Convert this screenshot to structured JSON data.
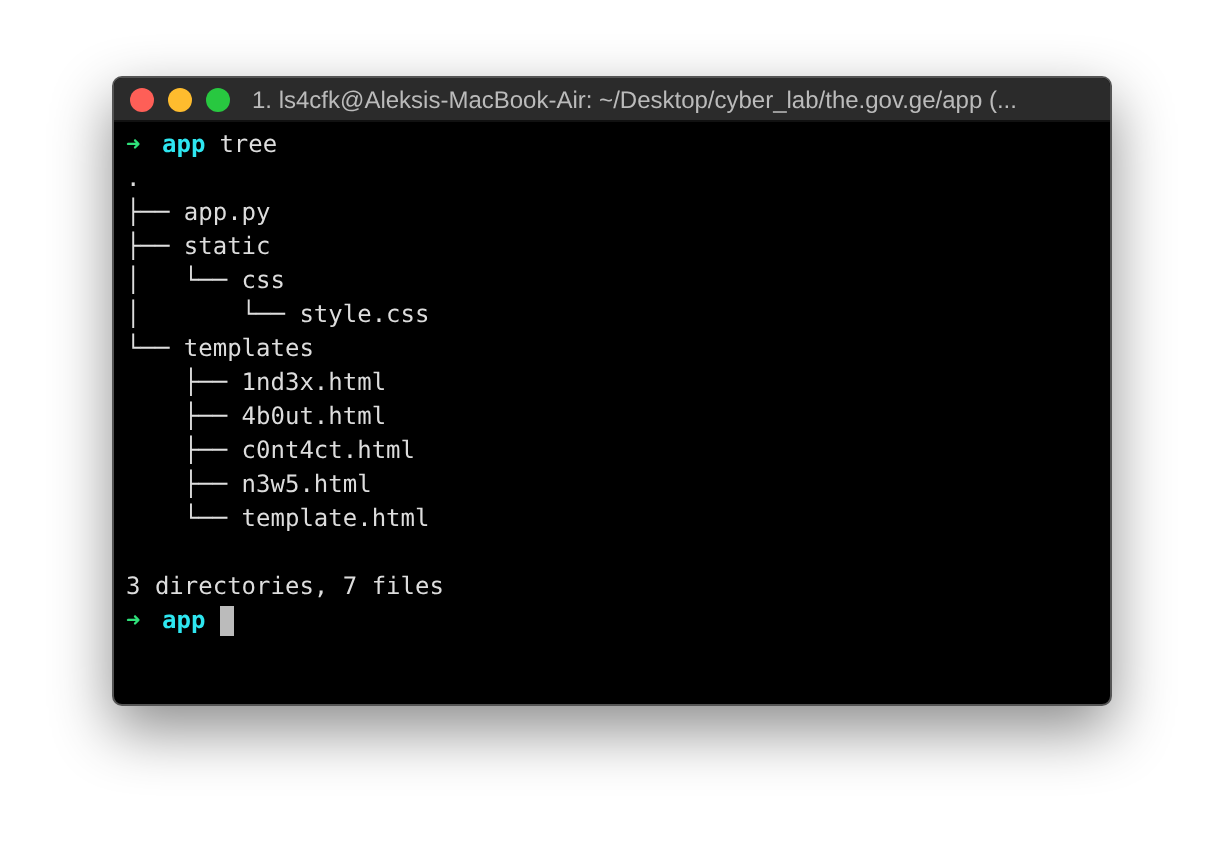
{
  "window": {
    "title": "1. ls4cfk@Aleksis-MacBook-Air: ~/Desktop/cyber_lab/the.gov.ge/app (..."
  },
  "lines": [
    {
      "kind": "prompt",
      "arrow": "➜",
      "directory": "app",
      "command": "tree",
      "cursor": false
    },
    {
      "kind": "output",
      "text": "."
    },
    {
      "kind": "output",
      "text": "├── app.py"
    },
    {
      "kind": "output",
      "text": "├── static"
    },
    {
      "kind": "output",
      "text": "│   └── css"
    },
    {
      "kind": "output",
      "text": "│       └── style.css"
    },
    {
      "kind": "output",
      "text": "└── templates"
    },
    {
      "kind": "output",
      "text": "    ├── 1nd3x.html"
    },
    {
      "kind": "output",
      "text": "    ├── 4b0ut.html"
    },
    {
      "kind": "output",
      "text": "    ├── c0nt4ct.html"
    },
    {
      "kind": "output",
      "text": "    ├── n3w5.html"
    },
    {
      "kind": "output",
      "text": "    └── template.html"
    },
    {
      "kind": "blank"
    },
    {
      "kind": "output",
      "text": "3 directories, 7 files"
    },
    {
      "kind": "prompt",
      "arrow": "➜",
      "directory": "app",
      "cursor": true
    }
  ]
}
